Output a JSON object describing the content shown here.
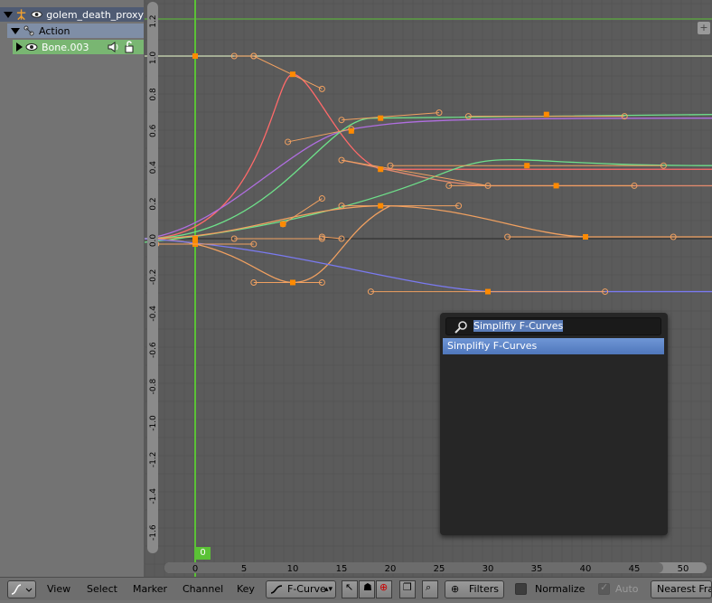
{
  "channels": {
    "object_name": "golem_death_proxy",
    "action_label": "Action",
    "bone_name": "Bone.003"
  },
  "graph": {
    "y_axis_ticks": [
      "1.2",
      "1.0",
      "0.8",
      "0.6",
      "0.4",
      "0.2",
      "0.0",
      "-0.2",
      "-0.4",
      "-0.6",
      "-0.8",
      "-1.0",
      "-1.2",
      "-1.4",
      "-1.6"
    ],
    "x_axis_ticks": [
      "0",
      "5",
      "10",
      "15",
      "20",
      "25",
      "30",
      "35",
      "40",
      "45",
      "50"
    ],
    "current_frame": "0",
    "colors": {
      "background": "#5b5b5b",
      "grid": "#555555",
      "frame_line": "#5bc236",
      "keyframe": "#ff8a00"
    }
  },
  "search_popup": {
    "query": "Simplifiy F-Curves",
    "results": [
      "Simplifiy F-Curves"
    ]
  },
  "header": {
    "menus": [
      "View",
      "Select",
      "Marker",
      "Channel",
      "Key"
    ],
    "mode_label": "F-Curve",
    "filters_label": "Filters",
    "normalize_label": "Normalize",
    "auto_label": "Auto",
    "snap_label": "Nearest Frame"
  },
  "icons": [
    "graph-editor-icon",
    "armature-icon",
    "eye-icon",
    "action-icon",
    "speaker-icon",
    "lock-icon",
    "cursor-icon",
    "ghost-icon",
    "pivot-icon",
    "copy-icon",
    "paste-icon",
    "zoom-icon",
    "filter-icon"
  ]
}
